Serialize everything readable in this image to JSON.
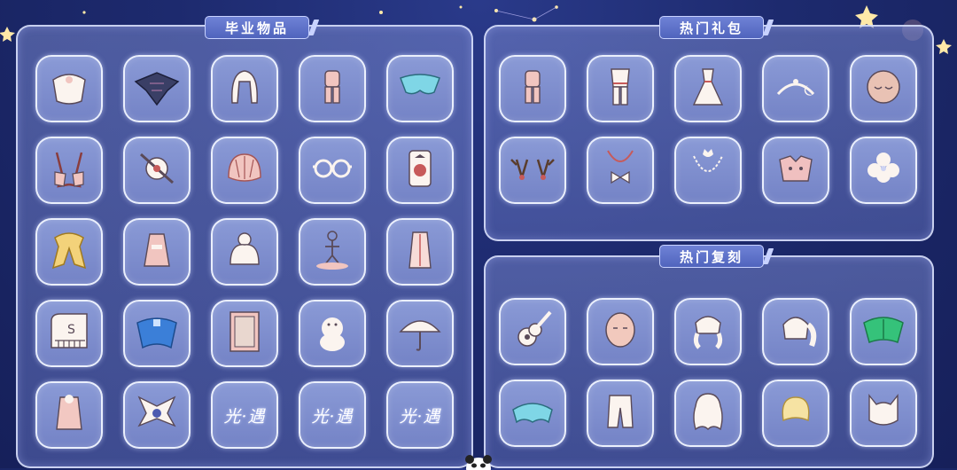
{
  "colors": {
    "background": "#1d2a6e",
    "panel": "#6f80c8",
    "slot": "#8090d2",
    "title_bar": "#5568c4",
    "outline": "#f0f4ff"
  },
  "panels": {
    "graduation": {
      "title": "毕业物品",
      "items": [
        {
          "icon": "white-cape-icon"
        },
        {
          "icon": "dark-bat-cape-icon"
        },
        {
          "icon": "white-long-hair-icon"
        },
        {
          "icon": "pink-outfit-icon"
        },
        {
          "icon": "cyan-butterfly-cape-icon"
        },
        {
          "icon": "pink-open-cape-icon"
        },
        {
          "icon": "sword-emblem-icon"
        },
        {
          "icon": "seashell-hair-icon"
        },
        {
          "icon": "glasses-icon"
        },
        {
          "icon": "lantern-prop-icon"
        },
        {
          "icon": "yellow-scarf-icon"
        },
        {
          "icon": "pink-dress-outfit-icon"
        },
        {
          "icon": "bun-hair-icon"
        },
        {
          "icon": "figure-statue-icon"
        },
        {
          "icon": "long-robe-outfit-icon"
        },
        {
          "icon": "piano-icon"
        },
        {
          "icon": "blue-cape-icon"
        },
        {
          "icon": "picture-frame-icon"
        },
        {
          "icon": "moomin-plush-icon"
        },
        {
          "icon": "umbrella-icon"
        },
        {
          "icon": "pink-coat-icon"
        },
        {
          "icon": "winged-emblem-icon"
        },
        {
          "icon": "sky-logo-placeholder",
          "text": "光·遇"
        },
        {
          "icon": "sky-logo-placeholder",
          "text": "光·遇"
        },
        {
          "icon": "sky-logo-placeholder",
          "text": "光·遇"
        }
      ]
    },
    "hot_packs": {
      "title": "热门礼包",
      "items": [
        {
          "icon": "pink-outfit-icon"
        },
        {
          "icon": "white-traditional-outfit-icon"
        },
        {
          "icon": "white-dress-icon"
        },
        {
          "icon": "moon-headpiece-icon"
        },
        {
          "icon": "sleeping-mask-icon"
        },
        {
          "icon": "antlers-icon"
        },
        {
          "icon": "bow-necklace-icon"
        },
        {
          "icon": "cat-necklace-icon"
        },
        {
          "icon": "dog-ears-hat-icon"
        },
        {
          "icon": "white-flower-icon"
        }
      ]
    },
    "hot_reruns": {
      "title": "热门复刻",
      "items": [
        {
          "icon": "ukulele-icon"
        },
        {
          "icon": "plain-mask-icon"
        },
        {
          "icon": "braided-hair-icon"
        },
        {
          "icon": "ponytail-hair-icon"
        },
        {
          "icon": "green-leaf-cape-icon"
        },
        {
          "icon": "cyan-cloud-cape-icon"
        },
        {
          "icon": "white-pants-icon"
        },
        {
          "icon": "wavy-long-hair-icon"
        },
        {
          "icon": "short-blonde-hair-icon"
        },
        {
          "icon": "cat-ears-hair-icon"
        }
      ]
    }
  }
}
